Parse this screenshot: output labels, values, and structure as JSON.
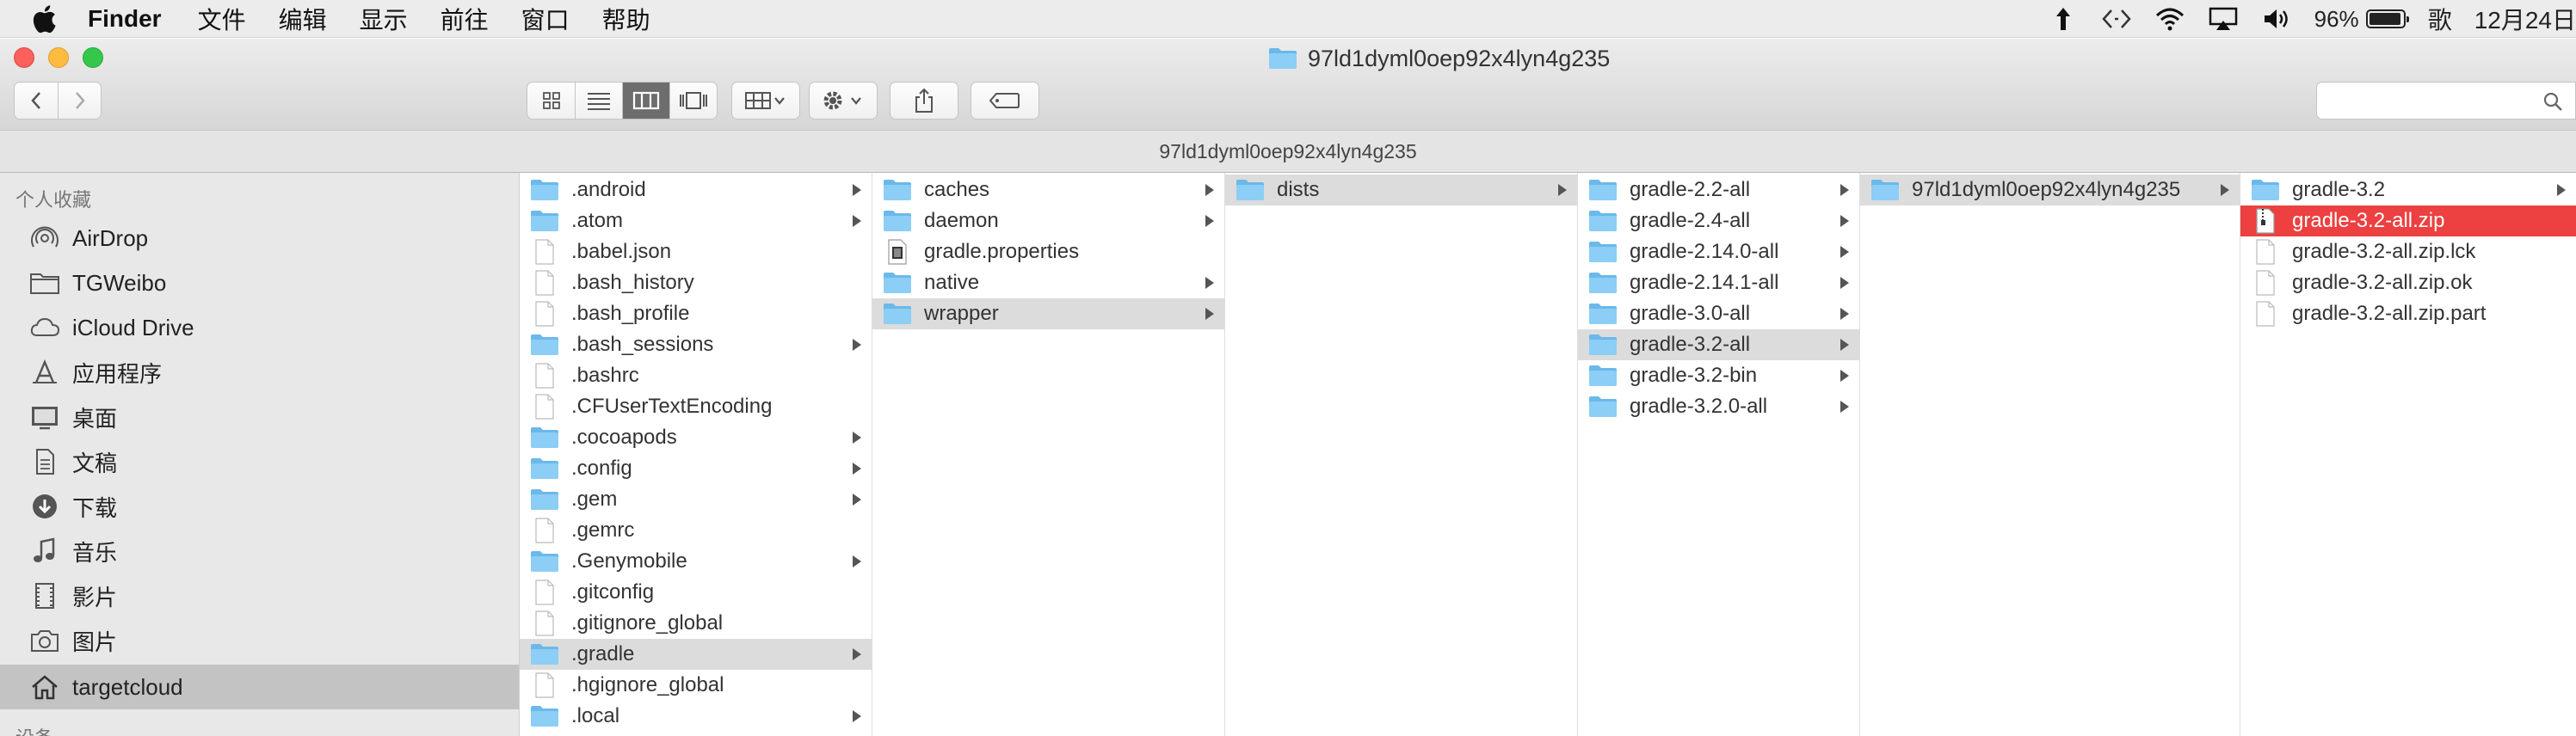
{
  "menubar": {
    "app_name": "Finder",
    "items": [
      "文件",
      "编辑",
      "显示",
      "前往",
      "窗口",
      "帮助"
    ],
    "battery_percent": "96%",
    "battery_level": 0.96,
    "ime_label": "歌",
    "clock": "12月24日"
  },
  "window": {
    "title": "97ld1dyml0oep92x4lyn4g235"
  },
  "pathbar": {
    "text": "97ld1dyml0oep92x4lyn4g235"
  },
  "sidebar": {
    "header": "个人收藏",
    "header2": "设备",
    "items": [
      {
        "label": "AirDrop",
        "icon": "airdrop-icon"
      },
      {
        "label": "TGWeibo",
        "icon": "folder-icon"
      },
      {
        "label": "iCloud Drive",
        "icon": "cloud-icon"
      },
      {
        "label": "应用程序",
        "icon": "applications-icon"
      },
      {
        "label": "桌面",
        "icon": "desktop-icon"
      },
      {
        "label": "文稿",
        "icon": "documents-icon"
      },
      {
        "label": "下载",
        "icon": "downloads-icon"
      },
      {
        "label": "音乐",
        "icon": "music-icon"
      },
      {
        "label": "影片",
        "icon": "movies-icon"
      },
      {
        "label": "图片",
        "icon": "camera-icon"
      },
      {
        "label": "targetcloud",
        "icon": "home-icon",
        "selected": true
      }
    ]
  },
  "columns": [
    {
      "items": [
        {
          "name": ".android",
          "type": "folder",
          "arrow": true
        },
        {
          "name": ".atom",
          "type": "folder",
          "arrow": true
        },
        {
          "name": ".babel.json",
          "type": "file"
        },
        {
          "name": ".bash_history",
          "type": "file"
        },
        {
          "name": ".bash_profile",
          "type": "file"
        },
        {
          "name": ".bash_sessions",
          "type": "folder",
          "arrow": true
        },
        {
          "name": ".bashrc",
          "type": "file"
        },
        {
          "name": ".CFUserTextEncoding",
          "type": "file"
        },
        {
          "name": ".cocoapods",
          "type": "folder",
          "arrow": true
        },
        {
          "name": ".config",
          "type": "folder",
          "arrow": true
        },
        {
          "name": ".gem",
          "type": "folder",
          "arrow": true
        },
        {
          "name": ".gemrc",
          "type": "file"
        },
        {
          "name": ".Genymobile",
          "type": "folder",
          "arrow": true
        },
        {
          "name": ".gitconfig",
          "type": "file"
        },
        {
          "name": ".gitignore_global",
          "type": "file"
        },
        {
          "name": ".gradle",
          "type": "folder",
          "arrow": true,
          "selected": true
        },
        {
          "name": ".hgignore_global",
          "type": "file"
        },
        {
          "name": ".local",
          "type": "folder",
          "arrow": true
        }
      ]
    },
    {
      "items": [
        {
          "name": "caches",
          "type": "folder",
          "arrow": true
        },
        {
          "name": "daemon",
          "type": "folder",
          "arrow": true
        },
        {
          "name": "gradle.properties",
          "type": "props"
        },
        {
          "name": "native",
          "type": "folder",
          "arrow": true
        },
        {
          "name": "wrapper",
          "type": "folder",
          "arrow": true,
          "selected": true
        }
      ]
    },
    {
      "items": [
        {
          "name": "dists",
          "type": "folder",
          "arrow": true,
          "selected": true
        }
      ]
    },
    {
      "items": [
        {
          "name": "gradle-2.2-all",
          "type": "folder",
          "arrow": true
        },
        {
          "name": "gradle-2.4-all",
          "type": "folder",
          "arrow": true
        },
        {
          "name": "gradle-2.14.0-all",
          "type": "folder",
          "arrow": true
        },
        {
          "name": "gradle-2.14.1-all",
          "type": "folder",
          "arrow": true
        },
        {
          "name": "gradle-3.0-all",
          "type": "folder",
          "arrow": true
        },
        {
          "name": "gradle-3.2-all",
          "type": "folder",
          "arrow": true,
          "selected": true
        },
        {
          "name": "gradle-3.2-bin",
          "type": "folder",
          "arrow": true
        },
        {
          "name": "gradle-3.2.0-all",
          "type": "folder",
          "arrow": true
        }
      ]
    },
    {
      "items": [
        {
          "name": "97ld1dyml0oep92x4lyn4g235",
          "type": "folder",
          "arrow": true,
          "selected": true
        }
      ]
    },
    {
      "items": [
        {
          "name": "gradle-3.2",
          "type": "folder",
          "arrow": true
        },
        {
          "name": "gradle-3.2-all.zip",
          "type": "zip",
          "active": true
        },
        {
          "name": "gradle-3.2-all.zip.lck",
          "type": "file"
        },
        {
          "name": "gradle-3.2-all.zip.ok",
          "type": "file"
        },
        {
          "name": "gradle-3.2-all.zip.part",
          "type": "file"
        }
      ]
    }
  ]
}
